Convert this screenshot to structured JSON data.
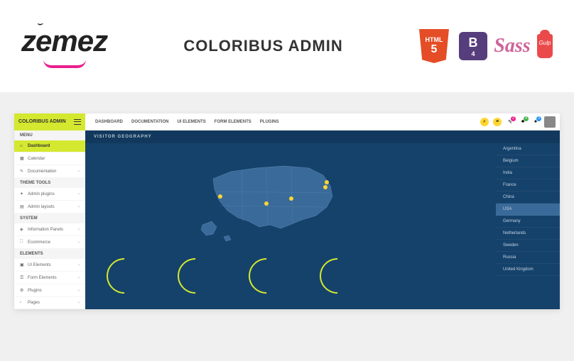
{
  "promo": {
    "logo": "zemez",
    "title": "COLORIBUS ADMIN",
    "tech": {
      "html5": "HTML",
      "bootstrap": "B",
      "sass": "Sass",
      "gulp": "Gulp"
    }
  },
  "brand": "COLORIBUS ADMIN",
  "topnav": [
    "DASHBOARD",
    "DOCUMENTATION",
    "UI ELEMENTS",
    "FORM ELEMENTS",
    "PLUGINS"
  ],
  "badges": {
    "b1": "2",
    "b2": "4",
    "b3": "3"
  },
  "sidebar": {
    "menu_label": "MENU",
    "menu": [
      {
        "icon": "⌂",
        "label": "Dashboard",
        "active": true,
        "chev": false
      },
      {
        "icon": "▦",
        "label": "Calendar",
        "chev": false
      },
      {
        "icon": "✎",
        "label": "Documentation",
        "chev": true
      }
    ],
    "theme_label": "THEME TOOLS",
    "theme": [
      {
        "icon": "✦",
        "label": "Admin plugins",
        "chev": true
      },
      {
        "icon": "▤",
        "label": "Admin layouts",
        "chev": true
      }
    ],
    "system_label": "SYSTEM",
    "system": [
      {
        "icon": "◈",
        "label": "Information Panels",
        "chev": true
      },
      {
        "icon": "⛶",
        "label": "Ecommerce",
        "chev": true
      }
    ],
    "elements_label": "ELEMENTS",
    "elements": [
      {
        "icon": "▣",
        "label": "UI Elements",
        "chev": true
      },
      {
        "icon": "☰",
        "label": "Form Elements",
        "chev": true
      },
      {
        "icon": "⚙",
        "label": "Plugins",
        "chev": true
      },
      {
        "icon": "▫",
        "label": "Pages",
        "chev": true
      }
    ]
  },
  "panel_title": "VISITOR GEOGRAPHY",
  "countries": [
    "Argentina",
    "Belgium",
    "India",
    "France",
    "China",
    "USA",
    "Germany",
    "Netherlands",
    "Sweden",
    "Russia",
    "United Kingdom"
  ],
  "selected_country": "USA"
}
